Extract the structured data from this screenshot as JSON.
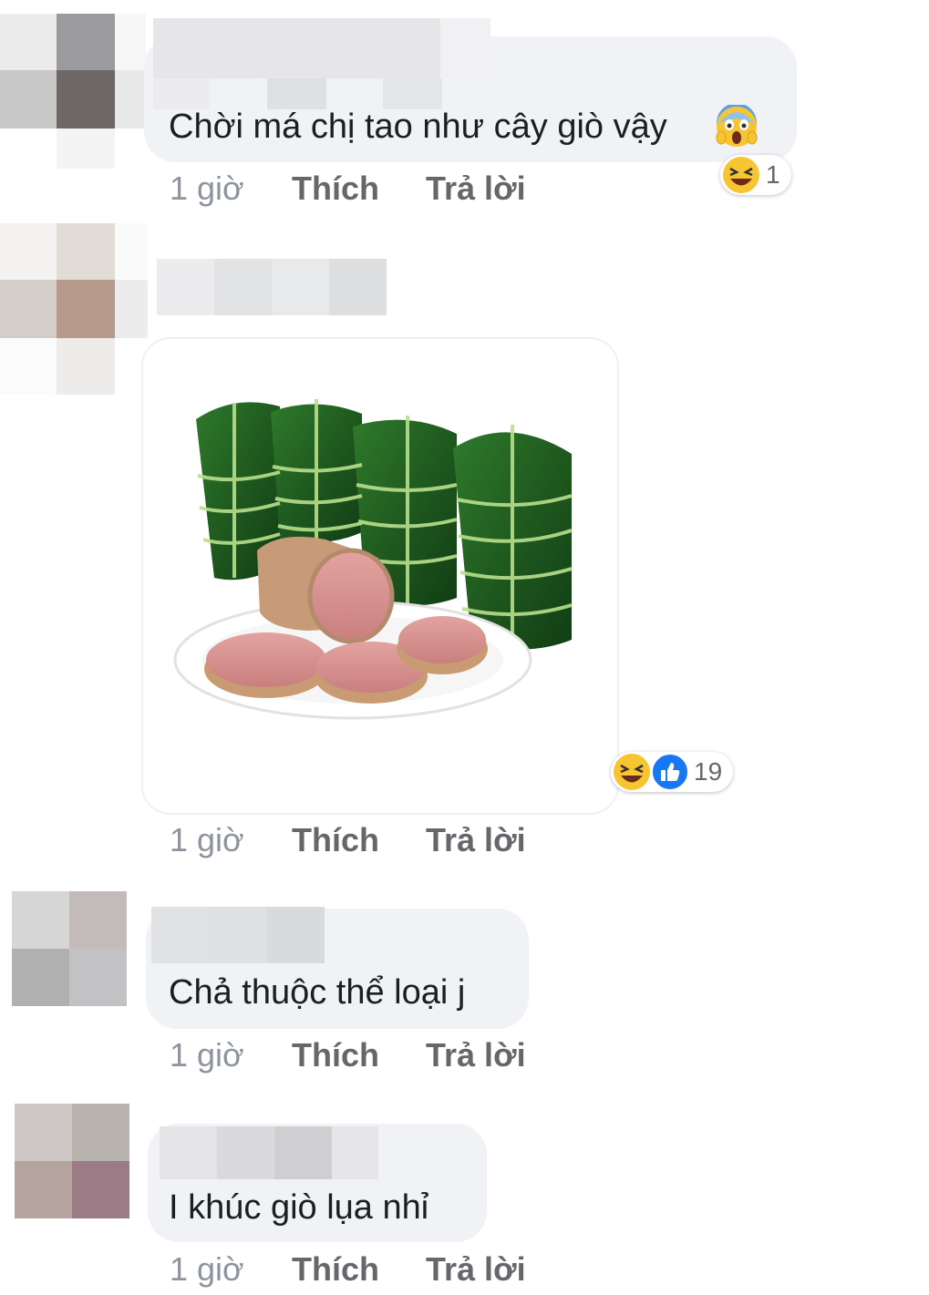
{
  "comments": [
    {
      "text": "Chời má chị tao như cây giò vậy",
      "time": "1 giờ",
      "like": "Thích",
      "reply": "Trả lời",
      "reaction_count": "1",
      "reactions": [
        "laughing-emoji"
      ],
      "inline_emoji": "scream-emoji"
    },
    {
      "image_alt": "",
      "time": "1 giờ",
      "like": "Thích",
      "reply": "Trả lời",
      "reaction_count": "19",
      "reactions": [
        "laughing-emoji",
        "like-emoji"
      ]
    },
    {
      "text": "Chả thuộc thể loại j",
      "time": "1 giờ",
      "like": "Thích",
      "reply": "Trả lời"
    },
    {
      "text": "I khúc giò lụa nhỉ",
      "time": "1 giờ",
      "like": "Thích",
      "reply": "Trả lời"
    }
  ],
  "colors": {
    "bubble": "#f0f2f5",
    "link": "#65676b",
    "time": "#8d949e",
    "like_blue": "#1877f2",
    "emoji_yellow": "#f7c531"
  }
}
